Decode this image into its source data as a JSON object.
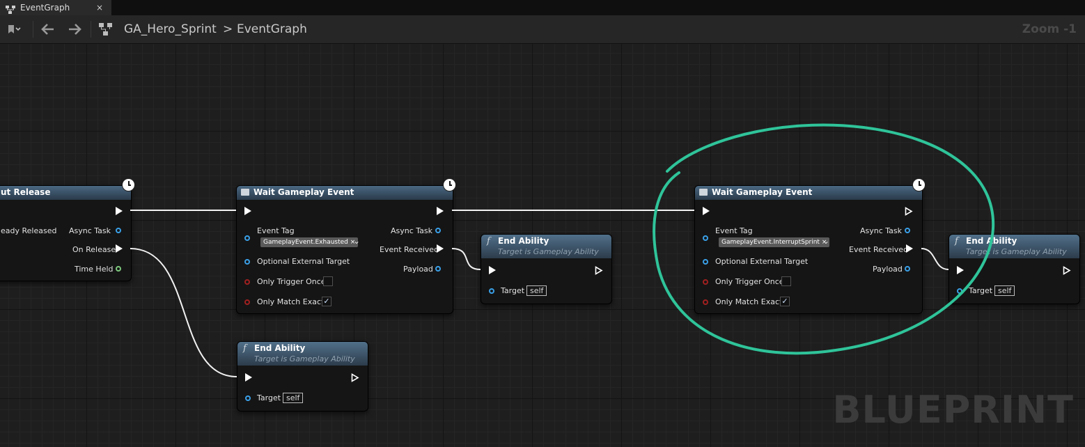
{
  "tab": {
    "label": "EventGraph",
    "close": "×",
    "icon": "graph-icon"
  },
  "toolbar": {
    "breadcrumb_blueprint": "GA_Hero_Sprint",
    "breadcrumb_sep": ">",
    "breadcrumb_graph": "EventGraph",
    "zoom": "Zoom -1",
    "icons": [
      "bookmark-icon",
      "back-arrow-icon",
      "forward-arrow-icon",
      "graph-hierarchy-icon"
    ]
  },
  "watermark": "BLUEPRINT",
  "nodes": {
    "input_release": {
      "title": "ut Release",
      "pins": {
        "already_released": "eady Released",
        "async_task": "Async Task",
        "on_release": "On Release",
        "time_held": "Time Held"
      }
    },
    "wait1": {
      "title": "Wait Gameplay Event",
      "pins": {
        "event_tag": "Event Tag",
        "tag": "GameplayEvent.Exhausted",
        "optional_target": "Optional External Target",
        "trigger_once": "Only Trigger Once",
        "match_exact": "Only Match Exact",
        "async_task": "Async Task",
        "event_received": "Event Received",
        "payload": "Payload"
      },
      "trigger_once_checked": false,
      "match_exact_checked": true
    },
    "end1": {
      "title": "End Ability",
      "subtitle": "Target is Gameplay Ability",
      "target_label": "Target",
      "target_value": "self"
    },
    "end2": {
      "title": "End Ability",
      "subtitle": "Target is Gameplay Ability",
      "target_label": "Target",
      "target_value": "self"
    },
    "wait2": {
      "title": "Wait Gameplay Event",
      "pins": {
        "event_tag": "Event Tag",
        "tag": "GameplayEvent.InterruptSprint",
        "optional_target": "Optional External Target",
        "trigger_once": "Only Trigger Once",
        "match_exact": "Only Match Exact",
        "async_task": "Async Task",
        "event_received": "Event Received",
        "payload": "Payload"
      },
      "trigger_once_checked": false,
      "match_exact_checked": true
    },
    "end3": {
      "title": "End Ability",
      "subtitle": "Target is Gameplay Ability",
      "target_label": "Target",
      "target_value": "self"
    }
  },
  "annotation_color": "#2fc49a",
  "check_mark": "✓",
  "tag_remove": "×",
  "tag_dropdown": "⌄"
}
